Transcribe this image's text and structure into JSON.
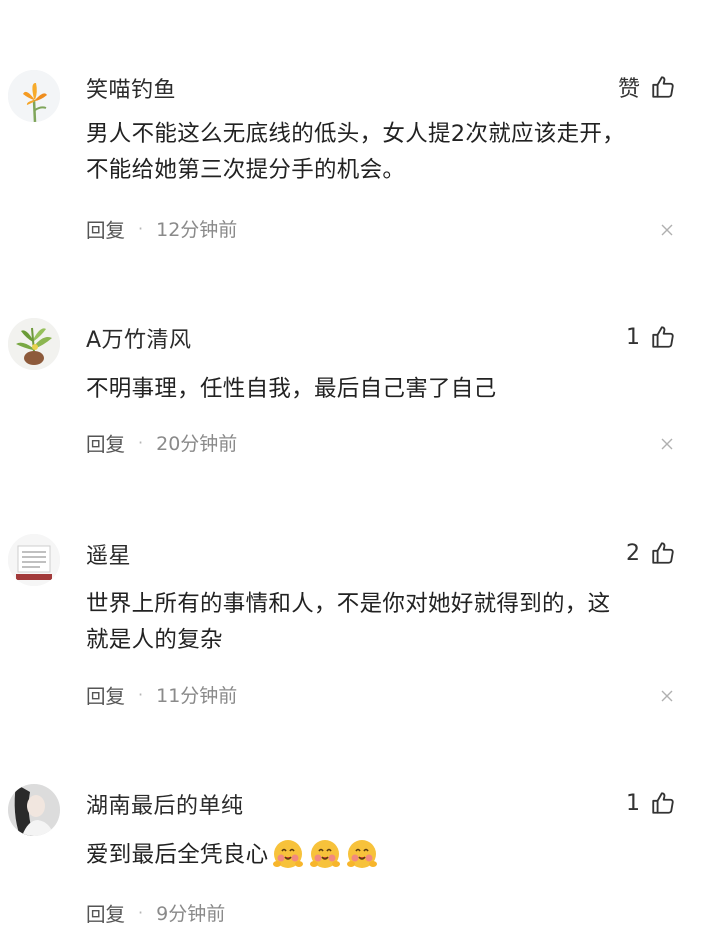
{
  "comments": [
    {
      "username": "笑喵钓鱼",
      "like_label": "赞",
      "lines": [
        "男人不能这么无底线的低头，女人提2次就应该走开，",
        "不能给她第三次提分手的机会。"
      ],
      "reply_label": "回复",
      "time": "12分钟前",
      "avatar": "orange-flower-avatar"
    },
    {
      "username": "A万竹清风",
      "like_label": "1",
      "lines": [
        "不明事理，任性自我，最后自己害了自己"
      ],
      "reply_label": "回复",
      "time": "20分钟前",
      "avatar": "potted-plant-avatar"
    },
    {
      "username": "遥星",
      "like_label": "2",
      "lines": [
        "世界上所有的事情和人，不是你对她好就得到的，这",
        "就是人的复杂"
      ],
      "reply_label": "回复",
      "time": "11分钟前",
      "avatar": "document-avatar"
    },
    {
      "username": "湖南最后的单纯",
      "like_label": "1",
      "lines": [
        "爱到最后全凭良心"
      ],
      "emojis": [
        "smiling-face-emoji",
        "smiling-face-emoji",
        "smiling-face-emoji"
      ],
      "reply_label": "回复",
      "time": "9分钟前",
      "avatar": "person-photo-avatar"
    }
  ],
  "icons": {
    "like": "thumbs-up-icon",
    "close": "close-icon"
  },
  "colors": {
    "text": "#222222",
    "meta": "#8a8a8a",
    "icon": "#333333"
  }
}
